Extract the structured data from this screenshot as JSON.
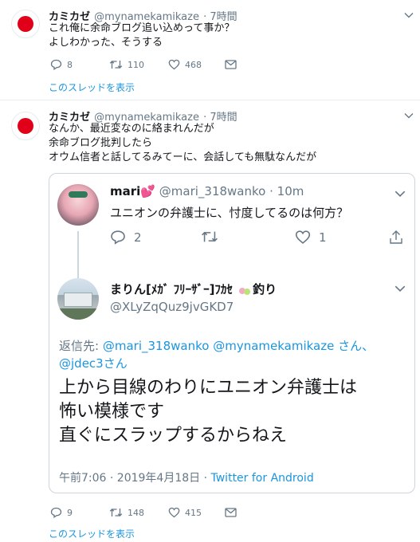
{
  "tweet1": {
    "name": "カミカゼ",
    "handle": "@mynamekamikaze",
    "time": "· 7時間",
    "text": "これ俺に余命ブログ追い込めって事か？\nよしわかった、そうする",
    "replies": "8",
    "retweets": "110",
    "likes": "468",
    "thread_link": "このスレッドを表示"
  },
  "tweet2": {
    "name": "カミカゼ",
    "handle": "@mynamekamikaze",
    "time": "· 7時間",
    "text": "なんか、最近変なのに絡まれんだが\n余命ブログ批判したら\nオウム信者と話してるみてーに、会話しても無駄なんだが",
    "replies": "9",
    "retweets": "148",
    "likes": "415",
    "thread_link": "このスレッドを表示"
  },
  "quoted_parent": {
    "name": "mari",
    "emoji": "💕",
    "handle": "@mari_318wanko",
    "time": "· 10m",
    "text": "ユニオンの弁護士に、忖度してるのは何方？",
    "replies": "2",
    "likes": "1"
  },
  "quoted_main": {
    "name": "まりん[ﾒｶﾞ ﾌﾘｰｻﾞｰ]ﾌｶｾ",
    "name_tail": "釣り",
    "handle": "@XLyZqQuz9jvGKD7",
    "reply_prefix": "返信先:",
    "reply_to_1": "@mari_318wanko",
    "reply_to_2": "@mynamekamikaze",
    "reply_to_3": "@jdec3",
    "reply_san_1": "さん、",
    "reply_san_2": "さん",
    "text": "上から目線のわりにユニオン弁護士は\n怖い模様です\n直ぐにスラップするからねえ",
    "timestamp": "午前7:06 · 2019年4月18日 ·",
    "source": "Twitter for Android"
  },
  "colors": {
    "accent": "#1b95e0",
    "muted": "#657786",
    "border": "#e6ecf0",
    "flag_red": "#e0001a"
  }
}
